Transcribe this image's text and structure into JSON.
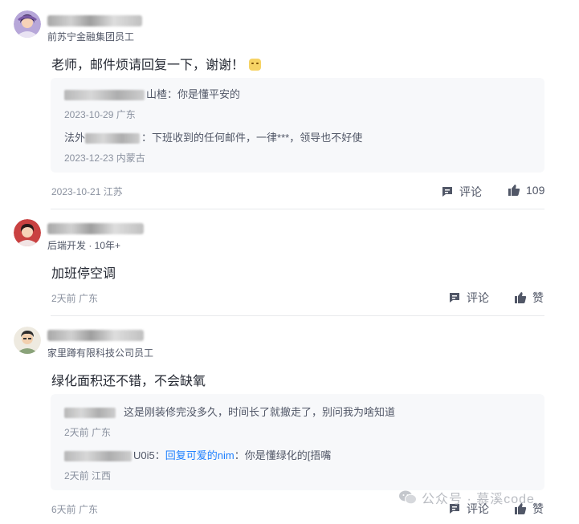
{
  "comments": [
    {
      "subtitle": "前苏宁金融集团员工",
      "content": "老师，邮件烦请回复一下，谢谢！",
      "emoji": "emoji-icon",
      "replies": [
        {
          "author_suffix": "山楂",
          "text": "：你是懂平安的",
          "meta": "2023-10-29 广东"
        },
        {
          "author_prefix": "法外",
          "text": "：下班收到的任何邮件，一律***，领导也不好使",
          "meta": "2023-12-23 内蒙古"
        }
      ],
      "meta": "2023-10-21 江苏",
      "comment_label": "评论",
      "like_label": "109"
    },
    {
      "subtitle": "后端开发 · 10年+",
      "content": "加班停空调",
      "meta": "2天前 广东",
      "comment_label": "评论",
      "like_label": "赞"
    },
    {
      "subtitle": "家里蹲有限科技公司员工",
      "content": "绿化面积还不错，不会缺氧",
      "replies": [
        {
          "text": "这是刚装修完没多久，时间长了就撤走了，别问我为啥知道",
          "meta": "2天前 广东"
        },
        {
          "author_suffix": "U0i5",
          "reply_to": "回复可爱的nim",
          "text": "：你是懂绿化的[捂嘴",
          "meta": "2天前 江西"
        }
      ],
      "meta": "6天前 广东",
      "comment_label": "评论",
      "like_label": "赞"
    }
  ],
  "watermark": "公众号 · 慕溪code",
  "colors": {
    "link": "#1e80ff",
    "meta": "#8a919f",
    "reply_bg": "#f7f8fa"
  }
}
